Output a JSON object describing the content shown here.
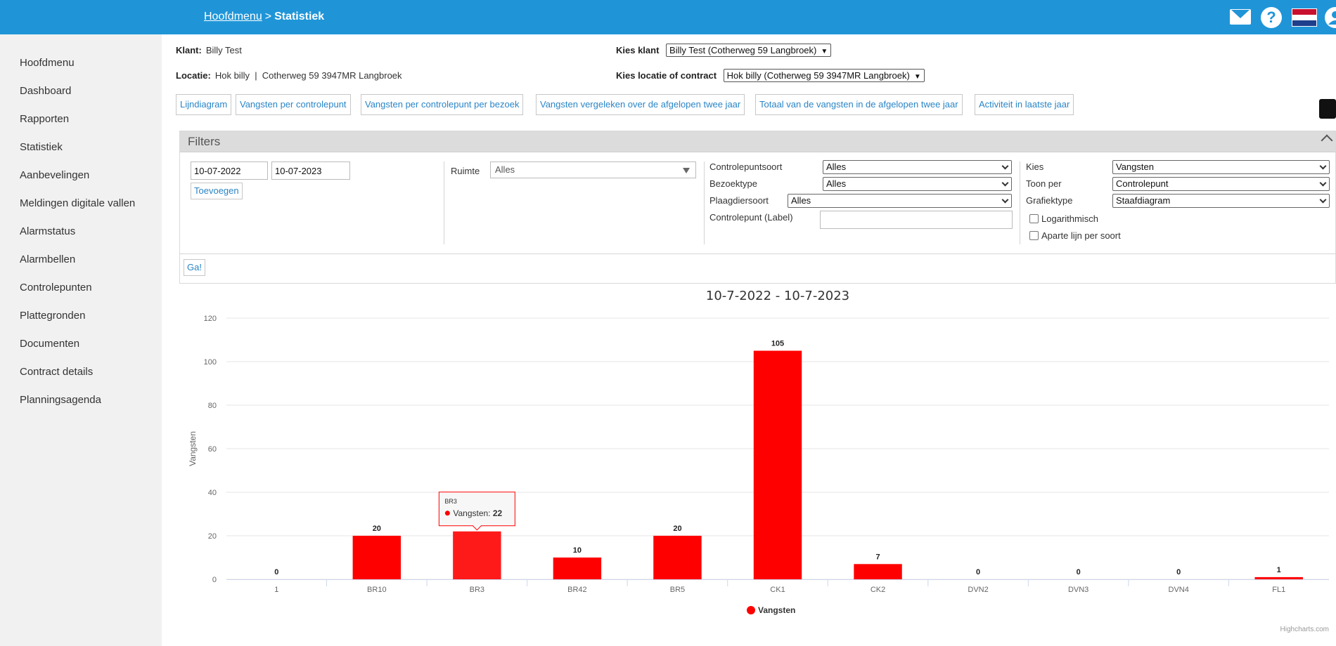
{
  "header": {
    "crumb_link": "Hoofdmenu",
    "crumb_sep": ">",
    "crumb_current": "Statistiek",
    "icons": [
      "mail-icon",
      "help-icon",
      "flag-nl-icon",
      "user-icon"
    ],
    "help_glyph": "?"
  },
  "sidebar": {
    "items": [
      "Hoofdmenu",
      "Dashboard",
      "Rapporten",
      "Statistiek",
      "Aanbevelingen",
      "Meldingen digitale vallen",
      "Alarmstatus",
      "Alarmbellen",
      "Controlepunten",
      "Plattegronden",
      "Documenten",
      "Contract details",
      "Planningsagenda"
    ]
  },
  "info": {
    "klant_label": "Klant:",
    "klant_value": "Billy Test",
    "locatie_label": "Locatie:",
    "locatie_value": "Hok billy  |  Cotherweg 59 3947MR Langbroek",
    "kies_klant_label": "Kies klant",
    "kies_klant_value": "Billy Test (Cotherweg 59 Langbroek)",
    "kies_locatie_label": "Kies locatie of contract",
    "kies_locatie_value": "Hok billy (Cotherweg 59 3947MR Langbroek)"
  },
  "tabs": [
    "Lijndiagram",
    "Vangsten per controlepunt",
    "Vangsten per controlepunt per bezoek",
    "Vangsten vergeleken over de afgelopen twee jaar",
    "Totaal van de vangsten in de afgelopen twee jaar",
    "Activiteit in laatste jaar"
  ],
  "filters": {
    "title": "Filters",
    "date_from": "10-07-2022",
    "date_to": "10-07-2023",
    "add_button": "Toevoegen",
    "ruimte_label": "Ruimte",
    "ruimte_value": "Alles",
    "controlepuntsoort_label": "Controlepuntsoort",
    "controlepuntsoort_value": "Alles",
    "bezoektype_label": "Bezoektype",
    "bezoektype_value": "Alles",
    "plaagdiersoort_label": "Plaagdiersoort",
    "plaagdiersoort_value": "Alles",
    "controlepunt_label": "Controlepunt (Label)",
    "controlepunt_value": "",
    "kies_label": "Kies",
    "kies_value": "Vangsten",
    "toon_per_label": "Toon per",
    "toon_per_value": "Controlepunt",
    "grafiektype_label": "Grafiektype",
    "grafiektype_value": "Staafdiagram",
    "log_label": "Logarithmisch",
    "log_checked": false,
    "aparte_label": "Aparte lijn per soort",
    "aparte_checked": false,
    "go_button": "Ga!"
  },
  "chart_data": {
    "type": "bar",
    "title": "10-7-2022 - 10-7-2023",
    "ylabel": "Vangsten",
    "xlabel": "",
    "ylim": [
      0,
      120
    ],
    "yticks": [
      0,
      20,
      40,
      60,
      80,
      100,
      120
    ],
    "categories": [
      "1",
      "BR10",
      "BR3",
      "BR42",
      "BR5",
      "CK1",
      "CK2",
      "DVN2",
      "DVN3",
      "DVN4",
      "FL1"
    ],
    "series": [
      {
        "name": "Vangsten",
        "values": [
          0,
          20,
          22,
          10,
          20,
          105,
          7,
          0,
          0,
          0,
          1
        ],
        "color": "#ff0000"
      }
    ],
    "data_labels": [
      "0",
      "20",
      "",
      "10",
      "20",
      "105",
      "7",
      "0",
      "0",
      "0",
      "1"
    ],
    "legend": "bottom-center",
    "grid": true,
    "tooltip": {
      "category": "BR3",
      "series": "Vangsten",
      "value": "22",
      "separator": ": "
    },
    "credits": "Highcharts.com"
  },
  "colors": {
    "topbar": "#1f95d8",
    "link": "#2a85c6",
    "bar": "#ff0000",
    "bar_hover": "#ff1a1a"
  }
}
